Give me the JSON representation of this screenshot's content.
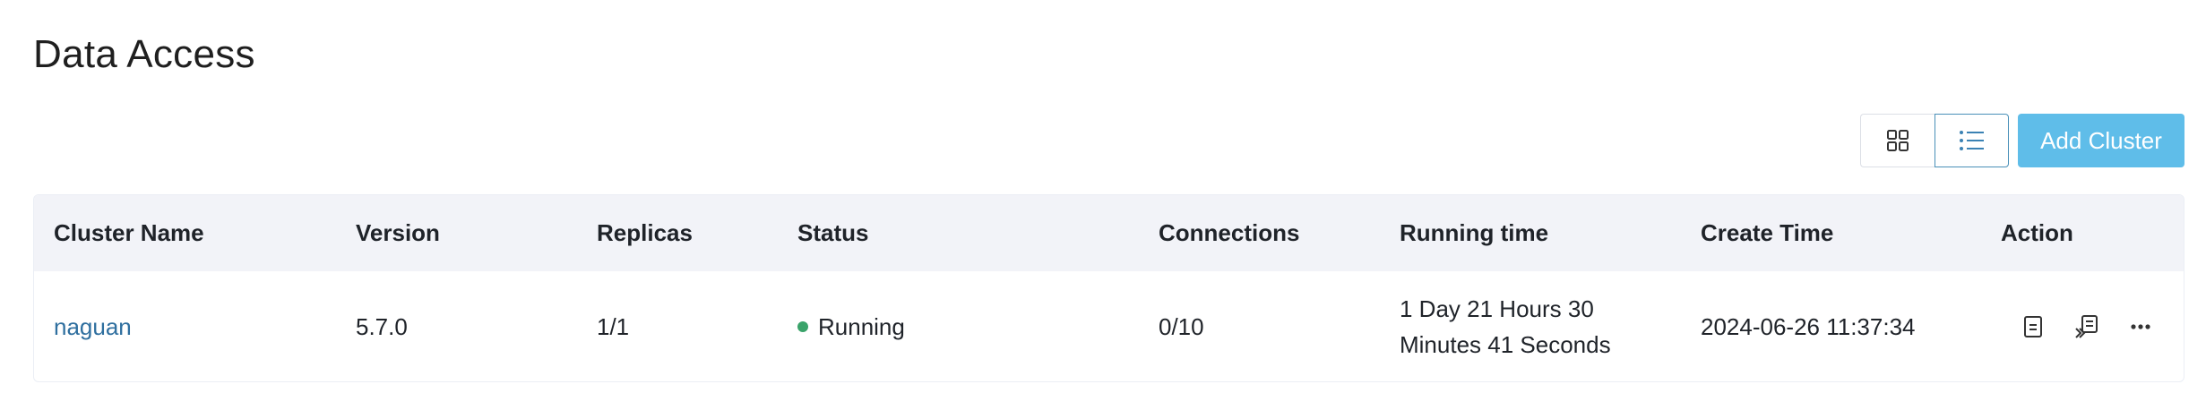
{
  "page": {
    "title": "Data Access"
  },
  "toolbar": {
    "grid_view_icon": "grid-icon",
    "list_view_icon": "list-icon",
    "add_label": "Add Cluster",
    "accent_color": "#5fbde9"
  },
  "table": {
    "columns": [
      "Cluster Name",
      "Version",
      "Replicas",
      "Status",
      "Connections",
      "Running time",
      "Create Time",
      "Action"
    ],
    "rows": [
      {
        "name": "naguan",
        "version": "5.7.0",
        "replicas": "1/1",
        "status": "Running",
        "status_color": "#3aa36a",
        "connections": "0/10",
        "running_time_line1": "1 Day 21 Hours 30",
        "running_time_line2": "Minutes 41 Seconds",
        "create_time": "2024-06-26 11:37:34",
        "actions": [
          "document-icon",
          "import-icon",
          "more-icon"
        ]
      }
    ]
  }
}
